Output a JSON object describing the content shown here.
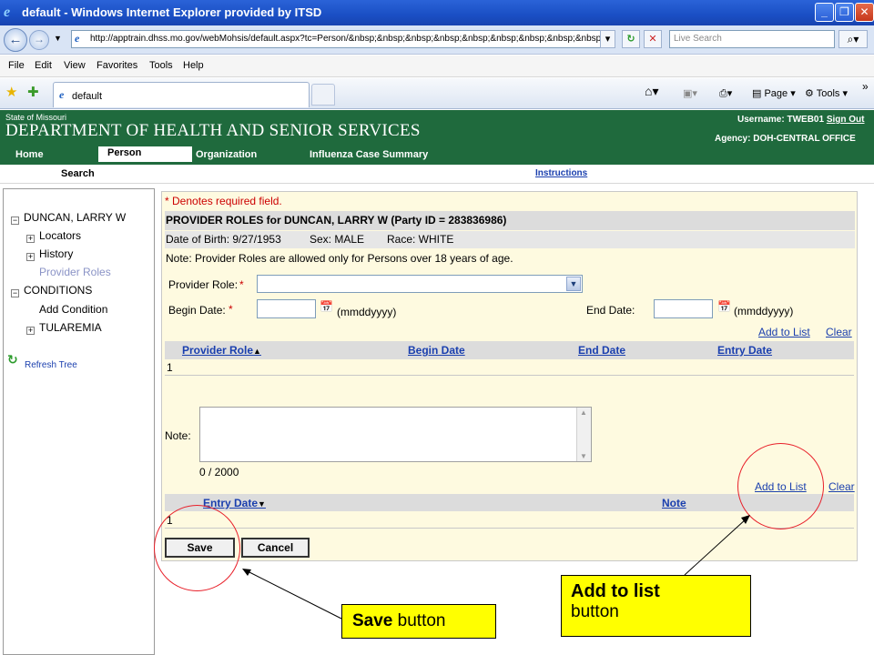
{
  "window": {
    "title": "default - Windows Internet Explorer provided by ITSD",
    "minimize": "_",
    "maximize": "❐",
    "close": "✕"
  },
  "addressbar": {
    "url": "http://apptrain.dhss.mo.gov/webMohsis/default.aspx?tc=Person/&nbsp;&nbsp;&nbsp;&nbsp;&nbsp;&nbsp;&nbsp;&nbsp;&nbsp;&nbsp;&",
    "search_placeholder": "Live Search"
  },
  "menu": [
    "File",
    "Edit",
    "View",
    "Favorites",
    "Tools",
    "Help"
  ],
  "browser_tab": {
    "label": "default"
  },
  "commandbar": {
    "page": "Page",
    "tools": "Tools"
  },
  "site": {
    "state": "State of Missouri",
    "department": "DEPARTMENT OF HEALTH AND SENIOR SERVICES",
    "username_label": "Username:",
    "username": "TWEB01",
    "sign_out": "Sign Out",
    "agency_label": "Agency:",
    "agency": "DOH-CENTRAL OFFICE",
    "nav": [
      "Home",
      "Person",
      "Organization",
      "Influenza Case Summary"
    ],
    "subnav_search": "Search",
    "instructions": "Instructions"
  },
  "tree": {
    "root": "DUNCAN, LARRY W",
    "locators": "Locators",
    "history": "History",
    "provider_roles": "Provider Roles",
    "conditions": "CONDITIONS",
    "add_condition": "Add Condition",
    "tularemia": "TULAREMIA",
    "refresh": "Refresh Tree"
  },
  "form": {
    "required_note": "* Denotes required field.",
    "header": "PROVIDER ROLES for DUNCAN, LARRY W (Party ID = 283836986)",
    "dob": "Date of Birth:  9/27/1953",
    "sex": "Sex:  MALE",
    "race": "Race:  WHITE",
    "note": "Note: Provider Roles are allowed only for Persons over 18 years of age.",
    "provider_role_label": "Provider Role:",
    "provider_role_value": "",
    "begin_date_label": "Begin Date:",
    "end_date_label": "End Date:",
    "date_format": "(mmddyyyy)",
    "asterisk": "*",
    "add_to_list": "Add to List",
    "clear": "Clear",
    "grid1": {
      "columns": [
        "Provider Role",
        "Begin Date",
        "End Date",
        "Entry Date"
      ],
      "sort_glyph": "▲",
      "row": "1"
    },
    "note_label": "Note:",
    "note_value": "",
    "note_counter": "0 / 2000",
    "grid2": {
      "columns": [
        "Entry Date",
        "Note"
      ],
      "sort_glyph": "▼",
      "row": "1"
    },
    "save": "Save",
    "cancel": "Cancel"
  },
  "annotations": {
    "add_to_list_bold": "Add to list",
    "add_to_list_rest": "button",
    "save_bold": "Save",
    "save_rest": "button",
    "circle_color": "#e8202a",
    "callout_color": "#ffff00"
  }
}
